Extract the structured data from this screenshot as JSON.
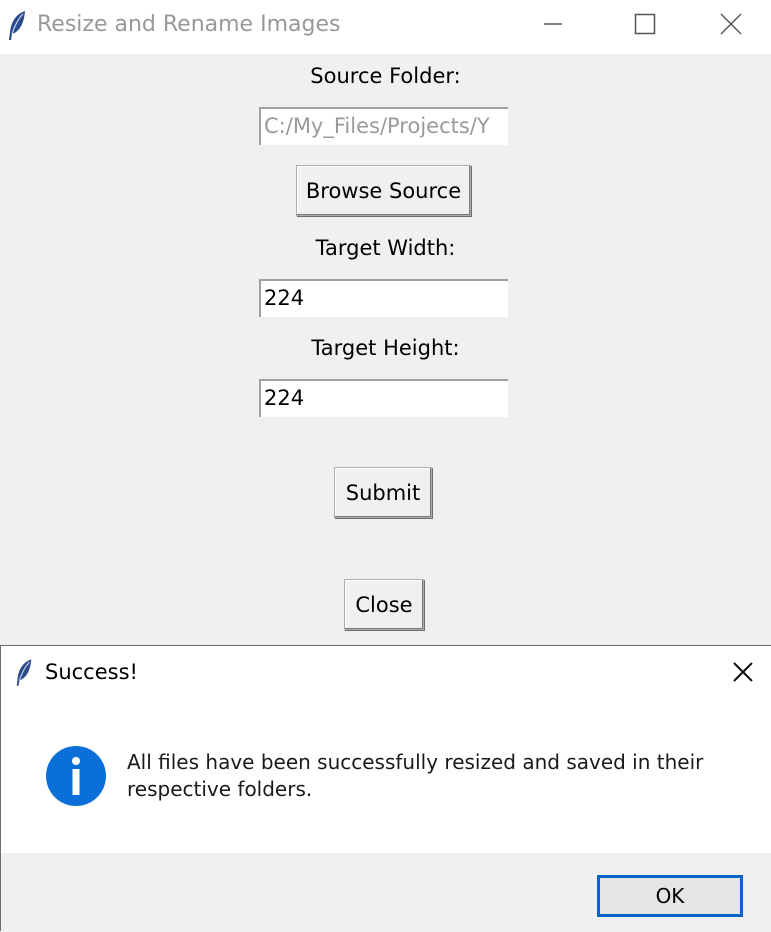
{
  "window": {
    "title": "Resize and Rename Images",
    "icon": "feather-icon"
  },
  "form": {
    "source_label": "Source Folder:",
    "source_value": "C:/My_Files/Projects/Y",
    "browse_label": "Browse Source",
    "width_label": "Target Width:",
    "width_value": "224",
    "height_label": "Target Height:",
    "height_value": "224",
    "submit_label": "Submit",
    "close_label": "Close"
  },
  "dialog": {
    "title": "Success!",
    "icon": "info-icon",
    "message": "All files have been successfully resized and saved in their respective folders.",
    "ok_label": "OK",
    "accent": "#0a64c8",
    "info_color": "#0a6fd6"
  }
}
